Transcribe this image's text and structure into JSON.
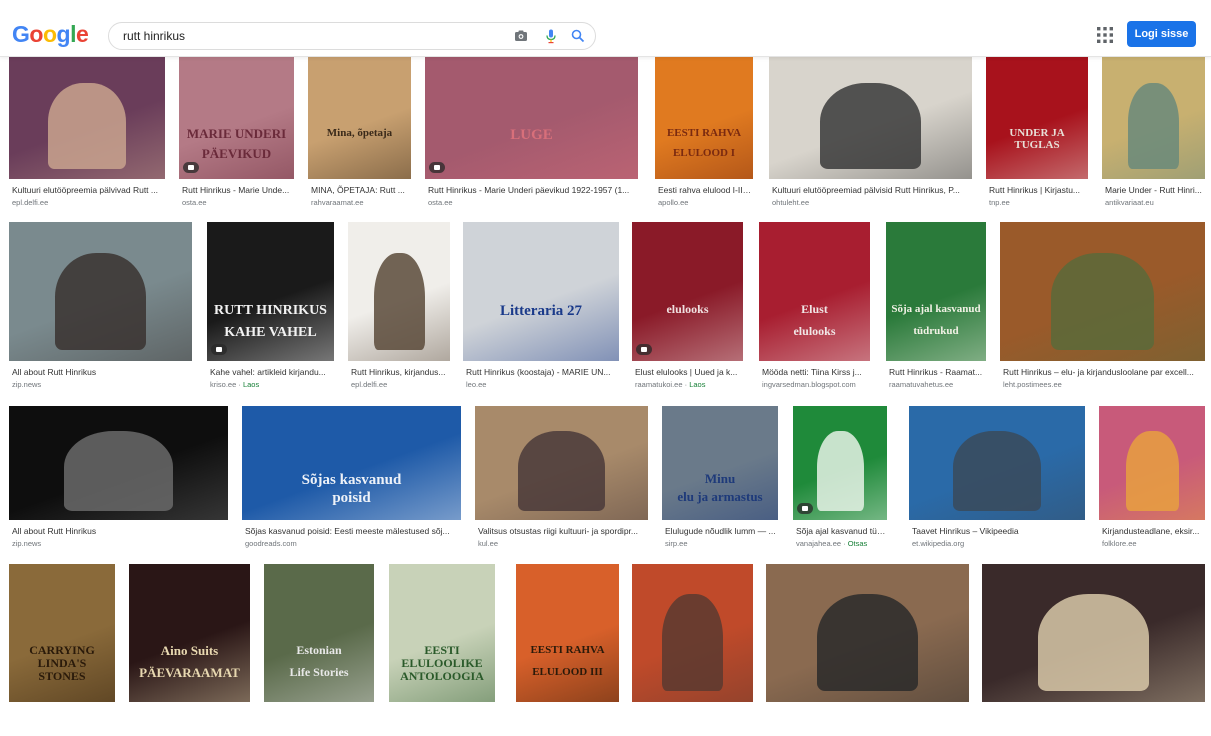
{
  "header": {
    "logo": [
      "G",
      "o",
      "o",
      "g",
      "l",
      "e"
    ],
    "logo_colors": [
      "#4285f4",
      "#ea4335",
      "#fbbc05",
      "#4285f4",
      "#34a853",
      "#ea4335"
    ],
    "search_value": "rutt hinrikus",
    "login_label": "Logi sisse"
  },
  "results": [
    {
      "caption": "Kultuuri elutööpreemia pälvivad Rutt ...",
      "source": "epl.delfi.ee",
      "bg": "#6a3d5a",
      "fg": "#c9a38e"
    },
    {
      "caption": "Rutt Hinrikus - Marie Unde...",
      "source": "osta.ee",
      "bg": "#b47a86",
      "fg": "#6a2a3a",
      "t1": "MARIE UNDERI",
      "t2": "PÄEVIKUD"
    },
    {
      "caption": "MINA, ÕPETAJA: Rutt ...",
      "source": "rahvaraamat.ee",
      "bg": "#c8a070",
      "fg": "#3a2a1a",
      "t1": "Mina, õpetaja"
    },
    {
      "caption": "Rutt Hinrikus - Marie Underi päevikud 1922-1957 (1...",
      "source": "osta.ee",
      "bg": "#a45a6e",
      "fg": "#d86f7a",
      "t1": "LUGE"
    },
    {
      "caption": "Eesti rahva elulood I-II -...",
      "source": "apollo.ee",
      "bg": "#e07a20",
      "fg": "#7a2a10",
      "t1": "EESTI RAHVA",
      "t2": "ELULOOD I"
    },
    {
      "caption": "Kultuuri elutööpreemiad pälvisid Rutt Hinrikus, P...",
      "source": "ohtuleht.ee",
      "bg": "#d8d4cc",
      "fg": "#3a3a3a"
    },
    {
      "caption": "Rutt Hinrikus | Kirjastu...",
      "source": "tnp.ee",
      "bg": "#a8121c",
      "fg": "#e8e0d8",
      "t1": "UNDER JA TUGLAS"
    },
    {
      "caption": "Marie Under - Rutt Hinri...",
      "source": "antikvariaat.eu",
      "bg": "#c8b070",
      "fg": "#6a8a7a"
    },
    {
      "caption": "All about Rutt Hinrikus",
      "source": "zip.news",
      "bg": "#7a8a8e",
      "fg": "#3a3330"
    },
    {
      "caption": "Kahe vahel: artikleid kirjandu...",
      "source": "kriso.ee · ",
      "source_extra": "Laos",
      "bg": "#1a1a1a",
      "fg": "#f2f2f2",
      "t1": "RUTT HINRIKUS",
      "t2": "KAHE VAHEL"
    },
    {
      "caption": "Rutt Hinrikus, kirjandus...",
      "source": "epl.delfi.ee",
      "bg": "#f0eeea",
      "fg": "#5a4a3a"
    },
    {
      "caption": "Rutt Hinrikus (koostaja) - MARIE UN...",
      "source": "leo.ee",
      "bg": "#cfd3d8",
      "fg": "#1a3a8a",
      "t1": "Litteraria 27"
    },
    {
      "caption": "Elust elulooks | Uued ja k...",
      "source": "raamatukoi.ee · ",
      "source_extra": "Laos",
      "bg": "#8a1a28",
      "fg": "#f0e0e0",
      "t1": "elulooks"
    },
    {
      "caption": "Mööda netti: Tiina Kirss j...",
      "source": "ingvarsedman.blogspot.com",
      "bg": "#a81e30",
      "fg": "#f0e6e6",
      "t1": "Elust",
      "t2": "elulooks"
    },
    {
      "caption": "Rutt Hinrikus - Raamat...",
      "source": "raamatuvahetus.ee",
      "bg": "#2a7a3a",
      "fg": "#f2f2e6",
      "t1": "Sõja ajal kasvanud",
      "t2": "tüdrukud"
    },
    {
      "caption": "Rutt Hinrikus – elu- ja kirjandusloolane par excell...",
      "source": "leht.postimees.ee",
      "bg": "#9a5a2a",
      "fg": "#5a6a3a"
    },
    {
      "caption": "All about Rutt Hinrikus",
      "source": "zip.news",
      "bg": "#0e0e0e",
      "fg": "#6a6a6a"
    },
    {
      "caption": "Sõjas kasvanud poisid: Eesti meeste mälestused sõj...",
      "source": "goodreads.com",
      "bg": "#1e5aa8",
      "fg": "#eef2f8",
      "t1": "Sõjas kasvanud",
      "t2": "poisid"
    },
    {
      "caption": "Valitsus otsustas riigi kultuuri- ja spordipr...",
      "source": "kul.ee",
      "bg": "#a88a6a",
      "fg": "#4a3a3a"
    },
    {
      "caption": "Elulugude nõudlik lumm — ...",
      "source": "sirp.ee",
      "bg": "#6a7a8a",
      "fg": "#1e3a7a",
      "t1": "Minu",
      "t2": "elu ja armastus"
    },
    {
      "caption": "Sõja ajal kasvanud tüdr...",
      "source": "vanajahea.ee · ",
      "source_extra": "Otsas",
      "bg": "#1f8a3a",
      "fg": "#e6f2e6"
    },
    {
      "caption": "Taavet Hinrikus – Vikipeedia",
      "source": "et.wikipedia.org",
      "bg": "#2a6aa8",
      "fg": "#3a4a5a"
    },
    {
      "caption": "Kirjandusteadlane, eksir...",
      "source": "folklore.ee",
      "bg": "#c85a7a",
      "fg": "#e8a040"
    },
    {
      "caption": "",
      "source": "",
      "bg": "#8a6a3a",
      "fg": "#2a1a0a",
      "t1": "CARRYING LINDA'S STONES"
    },
    {
      "caption": "",
      "source": "",
      "bg": "#2a1616",
      "fg": "#e8d8b0",
      "t1": "Aino Suits",
      "t2": "PÄEVARAAMAT"
    },
    {
      "caption": "",
      "source": "",
      "bg": "#5a6a4a",
      "fg": "#e8e8e8",
      "t1": "Estonian",
      "t2": "Life Stories"
    },
    {
      "caption": "",
      "source": "",
      "bg": "#c8d2b8",
      "fg": "#2a5a2a",
      "t1": "EESTI ELULOOLIKE ANTOLOOGIA"
    },
    {
      "caption": "",
      "source": "",
      "bg": "#d8602a",
      "fg": "#2a1a0a",
      "t1": "EESTI RAHVA",
      "t2": "ELULOOD III"
    },
    {
      "caption": "",
      "source": "",
      "bg": "#c04a2a",
      "fg": "#5a3a30"
    },
    {
      "caption": "",
      "source": "",
      "bg": "#8a6a50",
      "fg": "#2a2a2a"
    },
    {
      "caption": "",
      "source": "",
      "bg": "#3a2a2a",
      "fg": "#d8c8a8"
    }
  ]
}
